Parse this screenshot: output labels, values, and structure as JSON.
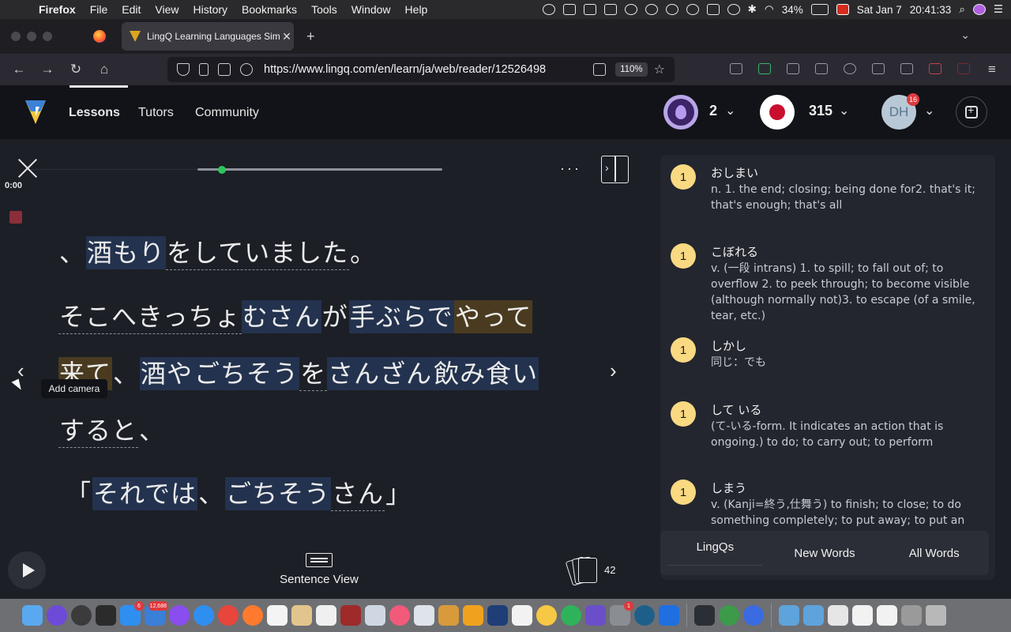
{
  "menubar": {
    "app": "Firefox",
    "items": [
      "File",
      "Edit",
      "View",
      "History",
      "Bookmarks",
      "Tools",
      "Window",
      "Help"
    ],
    "battery": "34%",
    "date": "Sat Jan 7",
    "time": "20:41:33"
  },
  "browser": {
    "tab_title": "LingQ Learning Languages Simpl",
    "url": "https://www.lingq.com/en/learn/ja/web/reader/12526498",
    "zoom": "110%"
  },
  "header": {
    "nav": [
      "Lessons",
      "Tutors",
      "Community"
    ],
    "streak": "2",
    "known_words": "315",
    "avatar_initials": "DH",
    "notifications": "16"
  },
  "reader": {
    "time": "0:00",
    "progress_fraction": 0.1,
    "tooltip": "Add camera",
    "lines": [
      [
        {
          "t": "、",
          "s": ""
        },
        {
          "t": "酒もり",
          "s": "blue"
        },
        {
          "t": "をしていました",
          "s": "known"
        },
        {
          "t": "。",
          "s": ""
        }
      ],
      [
        {
          "t": "そこへきっちょ",
          "s": "known"
        },
        {
          "t": "むさん",
          "s": "blue"
        },
        {
          "t": "が",
          "s": ""
        },
        {
          "t": "手ぶらで",
          "s": "blue"
        },
        {
          "t": "やって",
          "s": "yellow"
        }
      ],
      [
        {
          "t": "来て",
          "s": "yellow"
        },
        {
          "t": "、",
          "s": ""
        },
        {
          "t": "酒や",
          "s": "blue"
        },
        {
          "t": "ごちそう",
          "s": "blue"
        },
        {
          "t": "を",
          "s": "known"
        },
        {
          "t": "さんざん",
          "s": "blue"
        },
        {
          "t": "飲み食い",
          "s": "blue"
        }
      ],
      [
        {
          "t": "すると",
          "s": "known"
        },
        {
          "t": "、",
          "s": ""
        }
      ],
      [
        {
          "t": "「",
          "s": ""
        },
        {
          "t": "それでは",
          "s": "blue"
        },
        {
          "t": "、",
          "s": ""
        },
        {
          "t": "ごちそう",
          "s": "blue"
        },
        {
          "t": "さん",
          "s": "known"
        },
        {
          "t": "」",
          "s": ""
        }
      ]
    ],
    "sentence_view_label": "Sentence View",
    "flashcard_count": "42"
  },
  "panel": {
    "entries": [
      {
        "badge": "1",
        "term": "おしまい",
        "def": "n. 1. the end; closing; being done for2. that's it; that's enough; that's all"
      },
      {
        "badge": "1",
        "term": "こぼれる",
        "def": "v. (一段 intrans) 1. to spill; to fall out of; to overflow 2. to peek through; to become visible (although normally not)3. to escape (of a smile, tear, etc.)"
      },
      {
        "badge": "1",
        "term": "しかし",
        "def": "同じ：でも"
      },
      {
        "badge": "1",
        "term": "して いる",
        "def": "(て-いる-form. It indicates an action that is ongoing.) to do; to carry out; to perform"
      },
      {
        "badge": "1",
        "term": "しまう",
        "def": "v. (Kanji=終う,仕舞う) to finish; to close; to do something completely; to put away; to put an end"
      }
    ],
    "tabs": [
      "LingQs",
      "New Words",
      "All Words"
    ]
  },
  "dock_badges": {
    "mail": "6",
    "photos": "12,688",
    "settings": "1"
  }
}
